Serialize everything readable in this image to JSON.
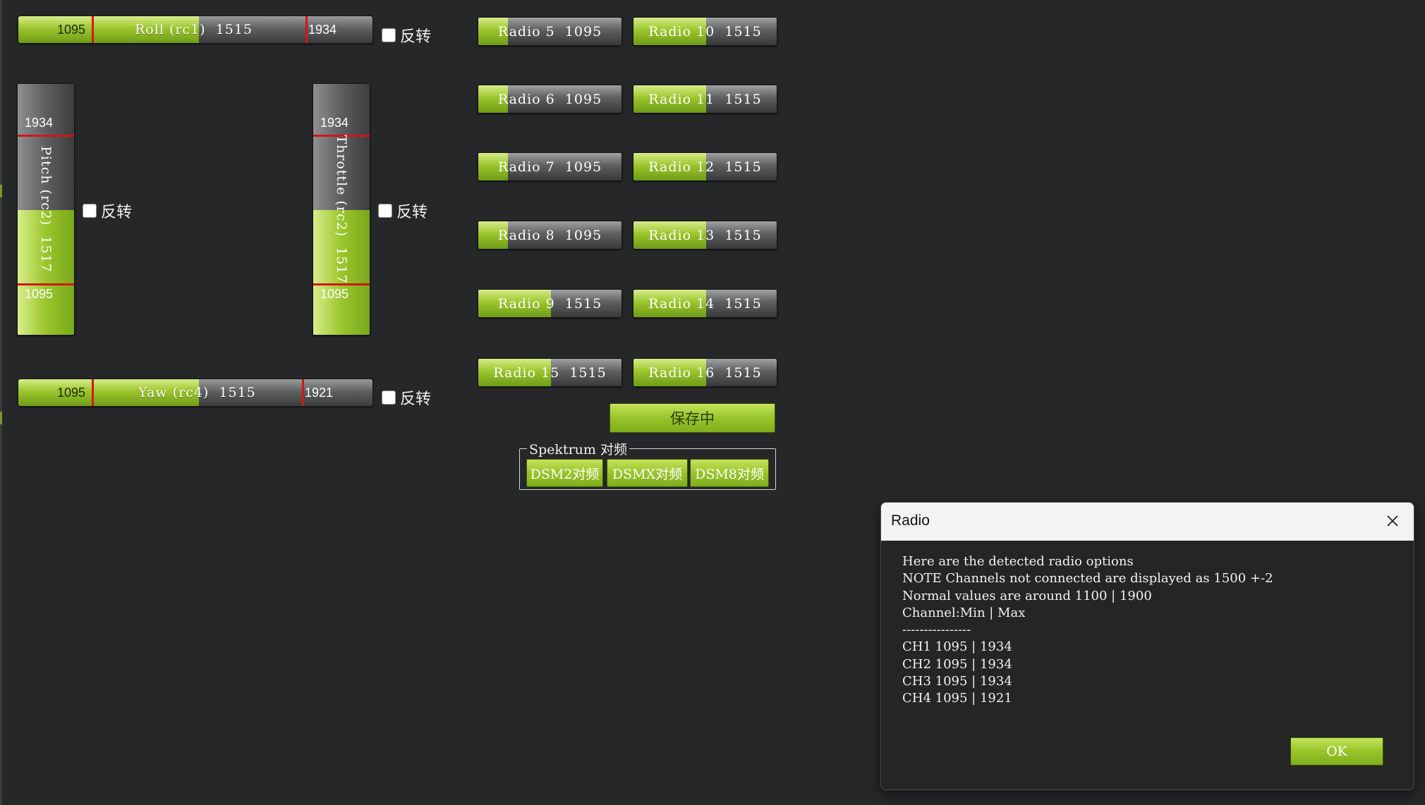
{
  "roll": {
    "min": "1095",
    "max": "1934",
    "label": "Roll (rc1)  1515",
    "value": 1515
  },
  "pitch": {
    "min": "1095",
    "max": "1934",
    "label": "Pitch (rc2)  1517",
    "value": 1517
  },
  "throttle": {
    "min": "1095",
    "max": "1934",
    "label": "Throttle (rc2)  1517",
    "value": 1517
  },
  "yaw": {
    "min": "1095",
    "max": "1921",
    "label": "Yaw (rc4)  1515",
    "value": 1515
  },
  "reverse_label": "反转",
  "radios": [
    {
      "label": "Radio 5  1095",
      "value": 1095
    },
    {
      "label": "Radio 6  1095",
      "value": 1095
    },
    {
      "label": "Radio 7  1095",
      "value": 1095
    },
    {
      "label": "Radio 8  1095",
      "value": 1095
    },
    {
      "label": "Radio 9  1515",
      "value": 1515
    },
    {
      "label": "Radio 10  1515",
      "value": 1515
    },
    {
      "label": "Radio 11  1515",
      "value": 1515
    },
    {
      "label": "Radio 12  1515",
      "value": 1515
    },
    {
      "label": "Radio 13  1515",
      "value": 1515
    },
    {
      "label": "Radio 14  1515",
      "value": 1515
    },
    {
      "label": "Radio 15  1515",
      "value": 1515
    },
    {
      "label": "Radio 16  1515",
      "value": 1515
    }
  ],
  "save_button": "保存中",
  "spektrum": {
    "legend": "Spektrum 对频",
    "buttons": [
      "DSM2对频",
      "DSMX对频",
      "DSM8对频"
    ]
  },
  "dialog": {
    "title": "Radio",
    "lines": [
      "Here are the detected radio options",
      "NOTE Channels not connected are displayed as 1500 +-2",
      "Normal values are around 1100 | 1900",
      "Channel:Min | Max",
      "----------------",
      "",
      "CH1 1095 | 1934",
      "CH2 1095 | 1934",
      "CH3 1095 | 1934",
      "CH4 1095 | 1921"
    ],
    "ok_label": "OK"
  },
  "colors": {
    "accent_green": "#9bc62c",
    "limit_marker": "#d81414",
    "background": "#262729"
  },
  "icons": {
    "close": "close-icon"
  }
}
